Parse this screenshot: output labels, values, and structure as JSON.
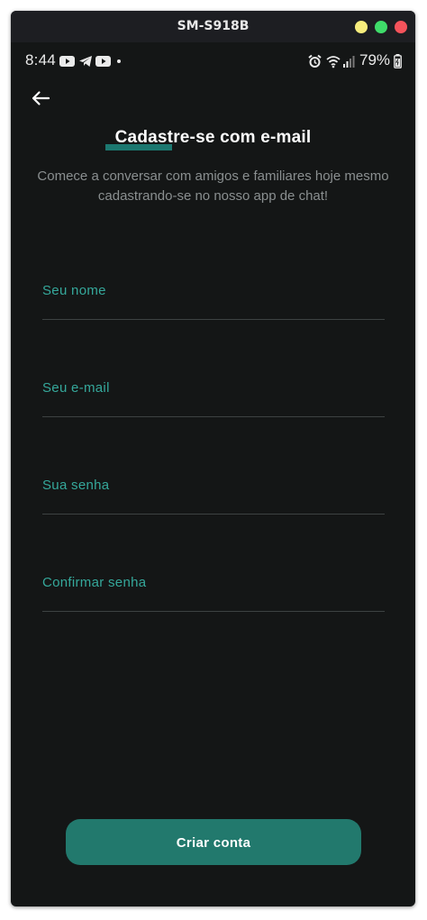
{
  "window": {
    "title": "SM-S918B"
  },
  "status_bar": {
    "time": "8:44",
    "battery": "79%",
    "left_icons": [
      "youtube-icon",
      "telegram-icon",
      "youtube-icon",
      "dot-icon"
    ],
    "right_icons": [
      "alarm-icon",
      "wifi-icon",
      "signal-icon",
      "battery-icon"
    ]
  },
  "header": {
    "back_icon": "arrow-left-icon",
    "title": "Cadastre-se com e-mail",
    "subtitle": "Comece a conversar com amigos e familiares hoje mesmo cadastrando-se no nosso app de chat!"
  },
  "form": {
    "name_label": "Seu nome",
    "email_label": "Seu e-mail",
    "password_label": "Sua senha",
    "confirm_label": "Confirmar senha"
  },
  "actions": {
    "submit_label": "Criar conta"
  },
  "colors": {
    "background": "#141616",
    "accent": "#35a89b",
    "button": "#22796d",
    "title_highlight": "#1f9a8f"
  }
}
